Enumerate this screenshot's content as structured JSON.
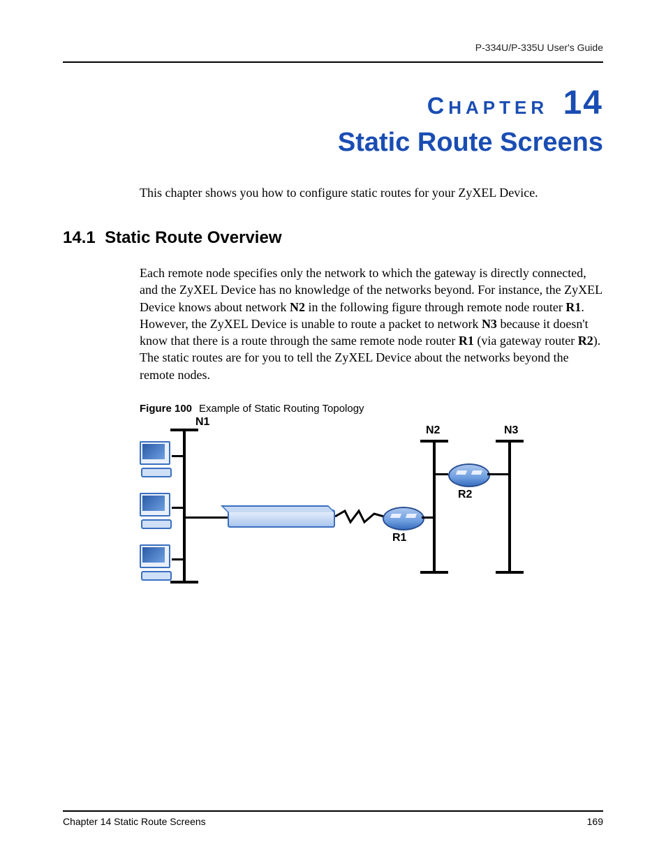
{
  "header": {
    "guide": "P-334U/P-335U User's Guide"
  },
  "chapter": {
    "smallcaps_prefix": "C",
    "smallcaps_rest": "HAPTER",
    "number": "14",
    "title": "Static Route Screens"
  },
  "intro": "This chapter shows you how to configure static routes for your ZyXEL Device.",
  "section": {
    "number": "14.1",
    "title": "Static Route Overview"
  },
  "paragraph": {
    "t0": "Each remote node specifies only the network to which the gateway is directly connected, and the ZyXEL Device has no knowledge of the networks beyond. For instance, the ZyXEL Device knows about network ",
    "b0": "N2",
    "t1": " in the following figure through remote node router ",
    "b1": "R1",
    "t2": ". However, the ZyXEL Device is unable to route a packet to network ",
    "b2": "N3",
    "t3": " because it doesn't know that there is a route through the same remote node router ",
    "b3": "R1",
    "t4": " (via gateway router ",
    "b4": "R2",
    "t5": "). The static routes are for you to tell the ZyXEL Device about the networks beyond the remote nodes."
  },
  "figure": {
    "label": "Figure 100",
    "caption": "Example of Static Routing Topology",
    "nodes": {
      "n1": "N1",
      "n2": "N2",
      "n3": "N3",
      "r1": "R1",
      "r2": "R2"
    }
  },
  "footer": {
    "left": "Chapter 14 Static Route Screens",
    "right": "169"
  }
}
